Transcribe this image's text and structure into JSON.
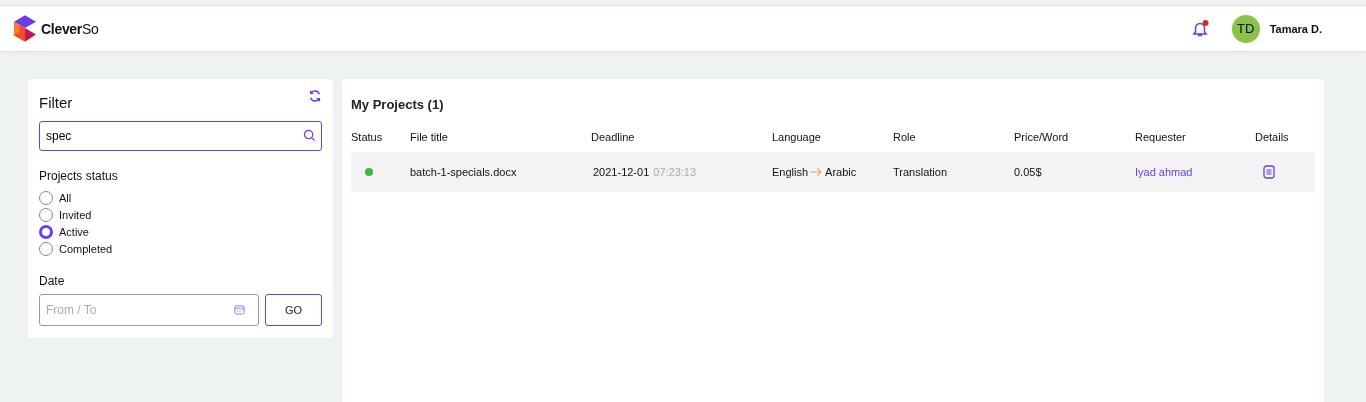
{
  "header": {
    "brand": {
      "name_bold": "Clever",
      "name_light": "So"
    },
    "notifications": {
      "unread": true
    },
    "user": {
      "initials": "TD",
      "name": "Tamara D."
    }
  },
  "filter": {
    "title": "Filter",
    "search": {
      "value": "spec"
    },
    "status_label": "Projects status",
    "statuses": [
      {
        "label": "All",
        "selected": false
      },
      {
        "label": "Invited",
        "selected": false
      },
      {
        "label": "Active",
        "selected": true
      },
      {
        "label": "Completed",
        "selected": false
      }
    ],
    "date_label": "Date",
    "date": {
      "placeholder": "From / To"
    },
    "go_button": "GO"
  },
  "projects": {
    "title": "My Projects (1)",
    "columns": [
      "Status",
      "File title",
      "Deadline",
      "Language",
      "Role",
      "Price/Word",
      "Requester",
      "Details"
    ],
    "rows": [
      {
        "color": "#3cb54a",
        "file_title": "batch-1-specials.docx",
        "deadline_date": "2021-12-01",
        "deadline_time": "07:23:13",
        "source_language": "English",
        "target_language": "Arabic",
        "role": "Translation",
        "price": "0.05$",
        "requester": "Iyad ahmad"
      }
    ]
  }
}
